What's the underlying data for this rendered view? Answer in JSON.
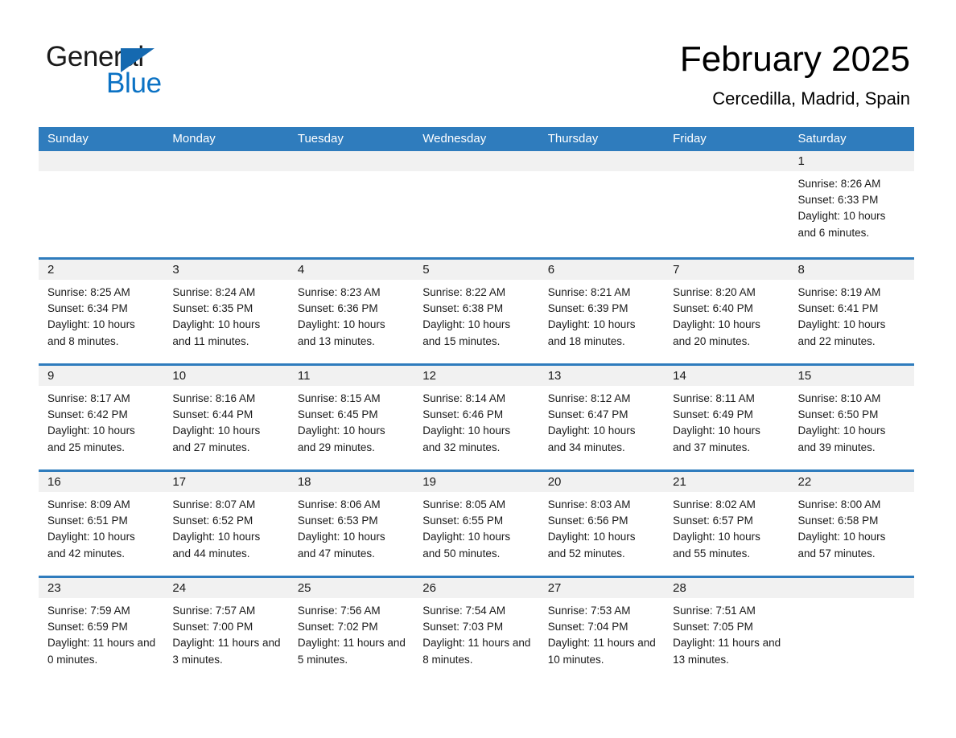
{
  "brand": {
    "name_part1": "General",
    "name_part2": "Blue",
    "triangle_color": "#1569b0",
    "blue_color": "#0b72c4"
  },
  "header": {
    "month_title": "February 2025",
    "location": "Cercedilla, Madrid, Spain"
  },
  "colors": {
    "header_bar": "#2f7cbd",
    "day_band": "#f1f1f1",
    "row_rule": "#2f7cbd"
  },
  "weekdays": [
    "Sunday",
    "Monday",
    "Tuesday",
    "Wednesday",
    "Thursday",
    "Friday",
    "Saturday"
  ],
  "weeks": [
    {
      "days": [
        {
          "number": "",
          "empty": true
        },
        {
          "number": "",
          "empty": true
        },
        {
          "number": "",
          "empty": true
        },
        {
          "number": "",
          "empty": true
        },
        {
          "number": "",
          "empty": true
        },
        {
          "number": "",
          "empty": true
        },
        {
          "number": "1",
          "empty": false,
          "sunrise": "Sunrise: 8:26 AM",
          "sunset": "Sunset: 6:33 PM",
          "daylight": "Daylight: 10 hours and 6 minutes."
        }
      ]
    },
    {
      "days": [
        {
          "number": "2",
          "empty": false,
          "sunrise": "Sunrise: 8:25 AM",
          "sunset": "Sunset: 6:34 PM",
          "daylight": "Daylight: 10 hours and 8 minutes."
        },
        {
          "number": "3",
          "empty": false,
          "sunrise": "Sunrise: 8:24 AM",
          "sunset": "Sunset: 6:35 PM",
          "daylight": "Daylight: 10 hours and 11 minutes."
        },
        {
          "number": "4",
          "empty": false,
          "sunrise": "Sunrise: 8:23 AM",
          "sunset": "Sunset: 6:36 PM",
          "daylight": "Daylight: 10 hours and 13 minutes."
        },
        {
          "number": "5",
          "empty": false,
          "sunrise": "Sunrise: 8:22 AM",
          "sunset": "Sunset: 6:38 PM",
          "daylight": "Daylight: 10 hours and 15 minutes."
        },
        {
          "number": "6",
          "empty": false,
          "sunrise": "Sunrise: 8:21 AM",
          "sunset": "Sunset: 6:39 PM",
          "daylight": "Daylight: 10 hours and 18 minutes."
        },
        {
          "number": "7",
          "empty": false,
          "sunrise": "Sunrise: 8:20 AM",
          "sunset": "Sunset: 6:40 PM",
          "daylight": "Daylight: 10 hours and 20 minutes."
        },
        {
          "number": "8",
          "empty": false,
          "sunrise": "Sunrise: 8:19 AM",
          "sunset": "Sunset: 6:41 PM",
          "daylight": "Daylight: 10 hours and 22 minutes."
        }
      ]
    },
    {
      "days": [
        {
          "number": "9",
          "empty": false,
          "sunrise": "Sunrise: 8:17 AM",
          "sunset": "Sunset: 6:42 PM",
          "daylight": "Daylight: 10 hours and 25 minutes."
        },
        {
          "number": "10",
          "empty": false,
          "sunrise": "Sunrise: 8:16 AM",
          "sunset": "Sunset: 6:44 PM",
          "daylight": "Daylight: 10 hours and 27 minutes."
        },
        {
          "number": "11",
          "empty": false,
          "sunrise": "Sunrise: 8:15 AM",
          "sunset": "Sunset: 6:45 PM",
          "daylight": "Daylight: 10 hours and 29 minutes."
        },
        {
          "number": "12",
          "empty": false,
          "sunrise": "Sunrise: 8:14 AM",
          "sunset": "Sunset: 6:46 PM",
          "daylight": "Daylight: 10 hours and 32 minutes."
        },
        {
          "number": "13",
          "empty": false,
          "sunrise": "Sunrise: 8:12 AM",
          "sunset": "Sunset: 6:47 PM",
          "daylight": "Daylight: 10 hours and 34 minutes."
        },
        {
          "number": "14",
          "empty": false,
          "sunrise": "Sunrise: 8:11 AM",
          "sunset": "Sunset: 6:49 PM",
          "daylight": "Daylight: 10 hours and 37 minutes."
        },
        {
          "number": "15",
          "empty": false,
          "sunrise": "Sunrise: 8:10 AM",
          "sunset": "Sunset: 6:50 PM",
          "daylight": "Daylight: 10 hours and 39 minutes."
        }
      ]
    },
    {
      "days": [
        {
          "number": "16",
          "empty": false,
          "sunrise": "Sunrise: 8:09 AM",
          "sunset": "Sunset: 6:51 PM",
          "daylight": "Daylight: 10 hours and 42 minutes."
        },
        {
          "number": "17",
          "empty": false,
          "sunrise": "Sunrise: 8:07 AM",
          "sunset": "Sunset: 6:52 PM",
          "daylight": "Daylight: 10 hours and 44 minutes."
        },
        {
          "number": "18",
          "empty": false,
          "sunrise": "Sunrise: 8:06 AM",
          "sunset": "Sunset: 6:53 PM",
          "daylight": "Daylight: 10 hours and 47 minutes."
        },
        {
          "number": "19",
          "empty": false,
          "sunrise": "Sunrise: 8:05 AM",
          "sunset": "Sunset: 6:55 PM",
          "daylight": "Daylight: 10 hours and 50 minutes."
        },
        {
          "number": "20",
          "empty": false,
          "sunrise": "Sunrise: 8:03 AM",
          "sunset": "Sunset: 6:56 PM",
          "daylight": "Daylight: 10 hours and 52 minutes."
        },
        {
          "number": "21",
          "empty": false,
          "sunrise": "Sunrise: 8:02 AM",
          "sunset": "Sunset: 6:57 PM",
          "daylight": "Daylight: 10 hours and 55 minutes."
        },
        {
          "number": "22",
          "empty": false,
          "sunrise": "Sunrise: 8:00 AM",
          "sunset": "Sunset: 6:58 PM",
          "daylight": "Daylight: 10 hours and 57 minutes."
        }
      ]
    },
    {
      "days": [
        {
          "number": "23",
          "empty": false,
          "sunrise": "Sunrise: 7:59 AM",
          "sunset": "Sunset: 6:59 PM",
          "daylight": "Daylight: 11 hours and 0 minutes."
        },
        {
          "number": "24",
          "empty": false,
          "sunrise": "Sunrise: 7:57 AM",
          "sunset": "Sunset: 7:00 PM",
          "daylight": "Daylight: 11 hours and 3 minutes."
        },
        {
          "number": "25",
          "empty": false,
          "sunrise": "Sunrise: 7:56 AM",
          "sunset": "Sunset: 7:02 PM",
          "daylight": "Daylight: 11 hours and 5 minutes."
        },
        {
          "number": "26",
          "empty": false,
          "sunrise": "Sunrise: 7:54 AM",
          "sunset": "Sunset: 7:03 PM",
          "daylight": "Daylight: 11 hours and 8 minutes."
        },
        {
          "number": "27",
          "empty": false,
          "sunrise": "Sunrise: 7:53 AM",
          "sunset": "Sunset: 7:04 PM",
          "daylight": "Daylight: 11 hours and 10 minutes."
        },
        {
          "number": "28",
          "empty": false,
          "sunrise": "Sunrise: 7:51 AM",
          "sunset": "Sunset: 7:05 PM",
          "daylight": "Daylight: 11 hours and 13 minutes."
        },
        {
          "number": "",
          "empty": true
        }
      ]
    }
  ]
}
